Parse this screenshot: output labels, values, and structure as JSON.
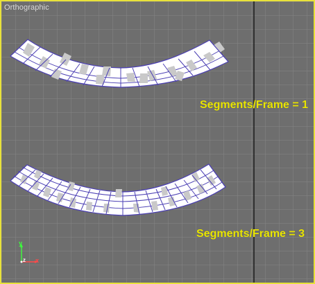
{
  "viewport": {
    "label": "Orthographic",
    "border_color": "#e8e23a",
    "background_color": "#6e6e6e"
  },
  "annotations": {
    "top": "Segments/Frame = 1",
    "bottom": "Segments/Frame = 3"
  },
  "gizmo": {
    "y": "y",
    "x": "x",
    "z": "z"
  },
  "colors": {
    "annotation": "#e9e500",
    "grid_line": "#8a8a8a",
    "vertical_divider": "#1a1a1a",
    "mesh_line": "#4b3fb4",
    "mesh_white": "#ffffff",
    "mesh_gray": "#c9c9c9"
  }
}
